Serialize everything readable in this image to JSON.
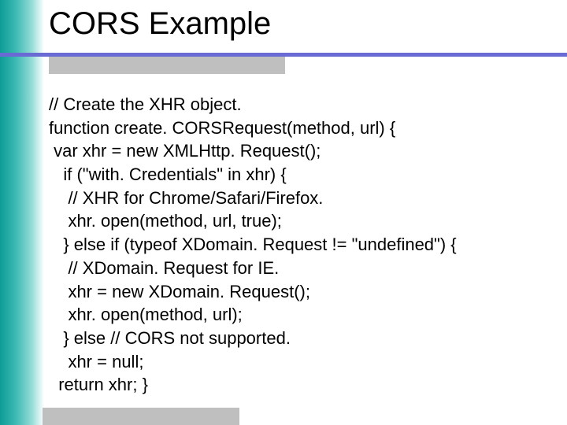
{
  "title": "CORS Example",
  "code": {
    "l01": "// Create the XHR object.",
    "l02": "function create. CORSRequest(method, url) {",
    "l03": " var xhr = new XMLHttp. Request();",
    "l04": "   if (\"with. Credentials\" in xhr) {",
    "l05": "    // XHR for Chrome/Safari/Firefox.",
    "l06": "    xhr. open(method, url, true);",
    "l07": "   } else if (typeof XDomain. Request != \"undefined\") {",
    "l08": "    // XDomain. Request for IE.",
    "l09": "    xhr = new XDomain. Request();",
    "l10": "    xhr. open(method, url);",
    "l11": "   } else // CORS not supported.",
    "l12": "    xhr = null;",
    "l13": "  return xhr; }"
  }
}
